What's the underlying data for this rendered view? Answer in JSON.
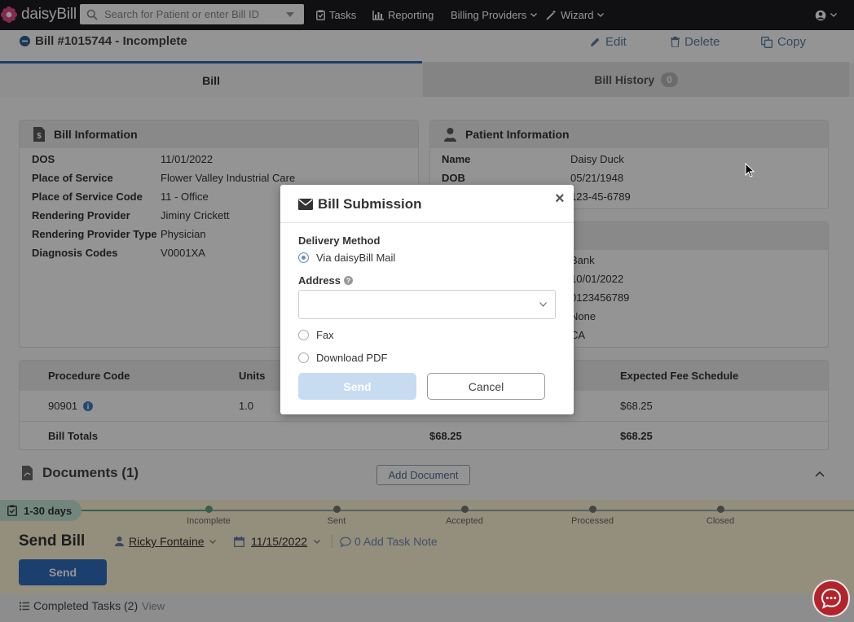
{
  "nav": {
    "logo": "daisyBill",
    "search_placeholder": "Search for Patient or enter Bill ID",
    "tasks": "Tasks",
    "reporting": "Reporting",
    "billing_providers": "Billing Providers",
    "wizard": "Wizard"
  },
  "bill": {
    "title": "Bill #1015744 - Incomplete",
    "edit": "Edit",
    "delete": "Delete",
    "copy": "Copy"
  },
  "tabs": {
    "bill": "Bill",
    "history": "Bill History",
    "history_count": "0"
  },
  "bill_info": {
    "heading": "Bill Information",
    "rows": [
      {
        "label": "DOS",
        "value": "11/01/2022"
      },
      {
        "label": "Place of Service",
        "value": "Flower Valley Industrial Care"
      },
      {
        "label": "Place of Service Code",
        "value": "11 - Office"
      },
      {
        "label": "Rendering Provider",
        "value": "Jiminy Crickett"
      },
      {
        "label": "Rendering Provider Type",
        "value": "Physician"
      },
      {
        "label": "Diagnosis Codes",
        "value": "V0001XA"
      }
    ]
  },
  "patient_info": {
    "heading": "Patient Information",
    "rows": [
      {
        "label": "Name",
        "value": "Daisy Duck"
      },
      {
        "label": "DOB",
        "value": "05/21/1948"
      },
      {
        "label": "",
        "value": "123-45-6789"
      }
    ]
  },
  "claim_partial": [
    "Bank",
    "10/01/2022",
    "0123456789",
    "None",
    "CA"
  ],
  "procedures": {
    "headers": [
      "Procedure Code",
      "Units",
      "Expected Fee Schedule"
    ],
    "rows": [
      {
        "code": "90901",
        "units": "1.0",
        "fee": "$68.25"
      }
    ],
    "totals_label": "Bill Totals",
    "total_mid": "$68.25",
    "total_fee": "$68.25"
  },
  "documents": {
    "heading": "Documents (1)",
    "add_button": "Add Document"
  },
  "workflow": {
    "age_badge": "1-30 days",
    "steps": [
      "Incomplete",
      "Sent",
      "Accepted",
      "Processed",
      "Closed"
    ],
    "title": "Send Bill",
    "assignee": "Ricky Fontaine",
    "due_date": "11/15/2022",
    "add_note": "0 Add Task Note",
    "send_button": "Send",
    "completed_tasks": "Completed Tasks (2)",
    "view": "View"
  },
  "modal": {
    "title": "Bill Submission",
    "delivery_label": "Delivery Method",
    "option_mail": "Via daisyBill Mail",
    "address_label": "Address",
    "address_value": "",
    "option_fax": "Fax",
    "option_pdf": "Download PDF",
    "send": "Send",
    "cancel": "Cancel",
    "close_glyph": "×"
  }
}
